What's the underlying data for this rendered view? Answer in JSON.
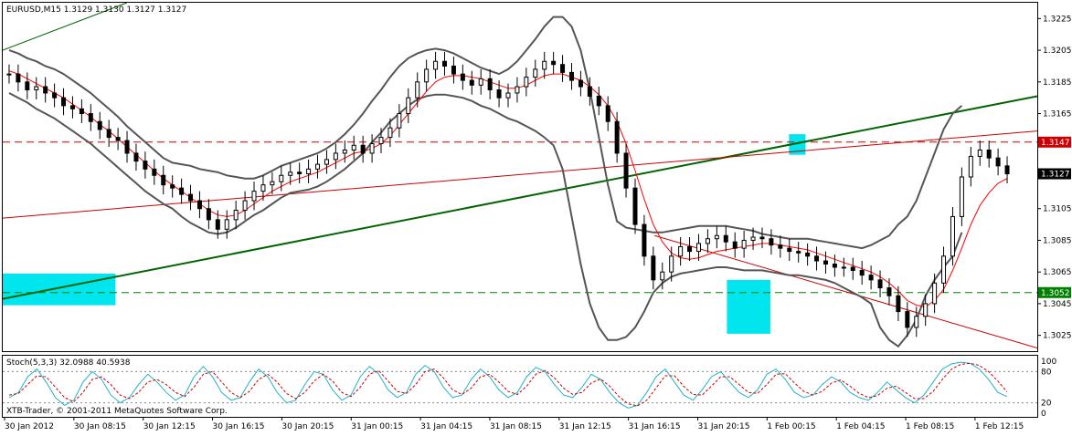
{
  "chart_data": {
    "type": "candlestick",
    "header": "EURUSD,M15  1.3129 1.3130 1.3127 1.3127",
    "colors": {
      "price": "#000000",
      "ma": "#ff0000",
      "bollinger": "#555555",
      "trend_green": "#006400",
      "trend_red": "#cc0000",
      "highlight": "#00e5ee",
      "stoch_main": "#20b2c8",
      "stoch_signal": "#cc0000",
      "level_red": "#cc0000",
      "level_green": "#008000"
    },
    "price_axis": {
      "min": 1.3015,
      "max": 1.3235,
      "ticks": [
        "1.3225",
        "1.3205",
        "1.3185",
        "1.3165",
        "1.3105",
        "1.3085",
        "1.3065",
        "1.3045",
        "1.3025"
      ],
      "tick_values": [
        1.3225,
        1.3205,
        1.3185,
        1.3165,
        1.3105,
        1.3085,
        1.3065,
        1.3045,
        1.3025
      ]
    },
    "time_axis": {
      "labels": [
        "30 Jan 2012",
        "30 Jan 08:15",
        "30 Jan 12:15",
        "30 Jan 16:15",
        "30 Jan 20:15",
        "31 Jan 00:15",
        "31 Jan 04:15",
        "31 Jan 08:15",
        "31 Jan 12:15",
        "31 Jan 16:15",
        "31 Jan 20:15",
        "1 Feb 00:15",
        "1 Feb 04:15",
        "1 Feb 08:15",
        "1 Feb 12:15"
      ]
    },
    "levels": [
      {
        "label": "1.3147",
        "value": 1.3147,
        "style": "red"
      },
      {
        "label": "1.3052",
        "value": 1.3052,
        "style": "green"
      }
    ],
    "current_price": {
      "label": "1.3127",
      "value": 1.3127
    },
    "price_series": {
      "close": [
        1.319,
        1.3185,
        1.318,
        1.3182,
        1.3178,
        1.3175,
        1.317,
        1.3168,
        1.3165,
        1.316,
        1.3155,
        1.315,
        1.3148,
        1.314,
        1.3135,
        1.313,
        1.3126,
        1.312,
        1.3118,
        1.3114,
        1.311,
        1.3105,
        1.3098,
        1.3092,
        1.3098,
        1.3104,
        1.311,
        1.3116,
        1.312,
        1.3122,
        1.3126,
        1.3128,
        1.3127,
        1.313,
        1.3133,
        1.3136,
        1.314,
        1.3142,
        1.3145,
        1.314,
        1.3146,
        1.315,
        1.3156,
        1.3165,
        1.3175,
        1.3185,
        1.3193,
        1.3198,
        1.3195,
        1.319,
        1.3186,
        1.3183,
        1.3187,
        1.318,
        1.3175,
        1.3178,
        1.3182,
        1.3188,
        1.3193,
        1.3198,
        1.3196,
        1.3191,
        1.3186,
        1.3182,
        1.3176,
        1.317,
        1.316,
        1.314,
        1.3118,
        1.3095,
        1.3075,
        1.306,
        1.3065,
        1.3075,
        1.3081,
        1.3078,
        1.3083,
        1.3086,
        1.3088,
        1.3084,
        1.308,
        1.3085,
        1.3087,
        1.3086,
        1.3082,
        1.308,
        1.3078,
        1.3077,
        1.3075,
        1.3072,
        1.307,
        1.3068,
        1.3068,
        1.3066,
        1.3063,
        1.306,
        1.3055,
        1.305,
        1.304,
        1.303,
        1.3037,
        1.3045,
        1.3058,
        1.3075,
        1.31,
        1.3125,
        1.3138,
        1.3142,
        1.3137,
        1.3132,
        1.3127
      ],
      "ma": [
        1.3192,
        1.319,
        1.3187,
        1.3184,
        1.3181,
        1.3178,
        1.3175,
        1.3171,
        1.3167,
        1.3163,
        1.3158,
        1.3154,
        1.3149,
        1.3144,
        1.3139,
        1.3134,
        1.3129,
        1.3124,
        1.312,
        1.3116,
        1.3112,
        1.3108,
        1.3104,
        1.3101,
        1.31,
        1.3101,
        1.3104,
        1.3108,
        1.3112,
        1.3116,
        1.3119,
        1.3122,
        1.3124,
        1.3126,
        1.3128,
        1.3131,
        1.3134,
        1.3137,
        1.314,
        1.3141,
        1.3143,
        1.3146,
        1.3151,
        1.3158,
        1.3165,
        1.3172,
        1.3179,
        1.3185,
        1.3188,
        1.3189,
        1.3189,
        1.3188,
        1.3187,
        1.3185,
        1.3183,
        1.3181,
        1.3181,
        1.3183,
        1.3186,
        1.3189,
        1.319,
        1.319,
        1.3188,
        1.3186,
        1.3182,
        1.3177,
        1.317,
        1.316,
        1.3146,
        1.3129,
        1.3111,
        1.3095,
        1.3084,
        1.3077,
        1.3074,
        1.3073,
        1.3074,
        1.3076,
        1.3078,
        1.3079,
        1.308,
        1.3081,
        1.3082,
        1.3083,
        1.3083,
        1.3082,
        1.3081,
        1.308,
        1.3079,
        1.3077,
        1.3075,
        1.3073,
        1.3071,
        1.3069,
        1.3067,
        1.3065,
        1.3062,
        1.3058,
        1.3053,
        1.3047,
        1.3044,
        1.3043,
        1.3047,
        1.3054,
        1.3066,
        1.308,
        1.3095,
        1.3107,
        1.3115,
        1.3121,
        1.3124
      ],
      "bb_upper": [
        1.3205,
        1.3203,
        1.32,
        1.3198,
        1.3195,
        1.3193,
        1.319,
        1.3186,
        1.3182,
        1.3178,
        1.3173,
        1.3168,
        1.3163,
        1.3157,
        1.3152,
        1.3147,
        1.3142,
        1.3137,
        1.3134,
        1.3133,
        1.3132,
        1.313,
        1.3129,
        1.3128,
        1.3126,
        1.3125,
        1.3124,
        1.3124,
        1.3126,
        1.3129,
        1.3132,
        1.3134,
        1.3136,
        1.3138,
        1.314,
        1.3143,
        1.3147,
        1.3152,
        1.3158,
        1.3165,
        1.3173,
        1.318,
        1.3188,
        1.3195,
        1.32,
        1.3203,
        1.3205,
        1.3206,
        1.3205,
        1.3203,
        1.32,
        1.3197,
        1.3194,
        1.3192,
        1.319,
        1.3193,
        1.3198,
        1.3205,
        1.3212,
        1.322,
        1.3226,
        1.3226,
        1.322,
        1.3205,
        1.318,
        1.315,
        1.312,
        1.3097,
        1.3093,
        1.3092,
        1.3091,
        1.309,
        1.309,
        1.3091,
        1.3092,
        1.3093,
        1.3094,
        1.3094,
        1.3094,
        1.3094,
        1.3093,
        1.3092,
        1.3091,
        1.3089,
        1.3088,
        1.3087,
        1.3086,
        1.3086,
        1.3086,
        1.3085,
        1.3084,
        1.3083,
        1.3082,
        1.3081,
        1.308,
        1.3082,
        1.3085,
        1.3088,
        1.3095,
        1.31,
        1.311,
        1.3125,
        1.314,
        1.3155,
        1.3165,
        1.317
      ],
      "bb_lower": [
        1.3178,
        1.3175,
        1.3172,
        1.3168,
        1.3165,
        1.3162,
        1.3158,
        1.3154,
        1.315,
        1.3146,
        1.3141,
        1.3136,
        1.3131,
        1.3126,
        1.3121,
        1.3116,
        1.3112,
        1.3108,
        1.3105,
        1.31,
        1.3096,
        1.3093,
        1.309,
        1.3089,
        1.309,
        1.3093,
        1.3097,
        1.3101,
        1.3104,
        1.3108,
        1.3112,
        1.3115,
        1.3116,
        1.3117,
        1.3119,
        1.3122,
        1.3126,
        1.313,
        1.3135,
        1.314,
        1.3147,
        1.3153,
        1.316,
        1.3165,
        1.317,
        1.3174,
        1.3176,
        1.3177,
        1.3177,
        1.3176,
        1.3175,
        1.3173,
        1.317,
        1.3168,
        1.3165,
        1.3162,
        1.316,
        1.3157,
        1.3154,
        1.315,
        1.3145,
        1.313,
        1.31,
        1.307,
        1.3045,
        1.303,
        1.3022,
        1.3022,
        1.3024,
        1.303,
        1.304,
        1.3052,
        1.3058,
        1.3062,
        1.3064,
        1.3065,
        1.3066,
        1.3067,
        1.3068,
        1.3068,
        1.3067,
        1.3066,
        1.3066,
        1.3066,
        1.3065,
        1.3064,
        1.3063,
        1.3063,
        1.3062,
        1.3061,
        1.306,
        1.3058,
        1.3055,
        1.3052,
        1.3049,
        1.3045,
        1.303,
        1.3022,
        1.3018,
        1.3025,
        1.3035,
        1.305,
        1.306,
        1.3068,
        1.3075,
        1.309
      ]
    },
    "highlight_boxes": [
      {
        "x0": 0.0,
        "x1": 0.109,
        "y0": 1.3064,
        "y1": 1.3044
      },
      {
        "x0": 0.7,
        "x1": 0.742,
        "y0": 1.306,
        "y1": 1.3026
      },
      {
        "x0": 0.76,
        "x1": 0.776,
        "y0": 1.3152,
        "y1": 1.3139
      }
    ],
    "trendlines": [
      {
        "name": "green",
        "x0": 0.0,
        "y0": 1.3048,
        "x1": 1.0,
        "y1": 1.3176
      },
      {
        "name": "red_up",
        "x0": 0.0,
        "y0": 1.3099,
        "x1": 1.0,
        "y1": 1.3154
      },
      {
        "name": "red_down",
        "x0": 0.63,
        "y0": 1.3088,
        "x1": 1.0,
        "y1": 1.3017
      },
      {
        "name": "thin_top",
        "x0": 0.0,
        "y0": 1.3205,
        "x1": 0.12,
        "y1": 1.3235
      }
    ],
    "stoch": {
      "label": "Stoch(5,3,3) 32.0988 40.5938",
      "axis_ticks": [
        "100",
        "80",
        "20",
        "0"
      ],
      "axis_values": [
        100,
        80,
        20,
        0
      ],
      "main": [
        30,
        40,
        70,
        85,
        60,
        30,
        15,
        25,
        60,
        80,
        65,
        35,
        20,
        30,
        55,
        75,
        60,
        40,
        25,
        35,
        70,
        90,
        70,
        40,
        25,
        30,
        60,
        85,
        70,
        40,
        20,
        25,
        55,
        80,
        75,
        45,
        25,
        35,
        70,
        90,
        75,
        45,
        30,
        40,
        75,
        92,
        80,
        50,
        30,
        35,
        65,
        85,
        70,
        45,
        30,
        40,
        70,
        88,
        80,
        55,
        35,
        30,
        50,
        75,
        65,
        40,
        20,
        10,
        15,
        40,
        70,
        85,
        60,
        35,
        25,
        45,
        70,
        80,
        60,
        40,
        30,
        45,
        75,
        85,
        65,
        40,
        30,
        35,
        55,
        70,
        60,
        40,
        30,
        25,
        40,
        60,
        45,
        30,
        20,
        35,
        60,
        85,
        95,
        98,
        96,
        85,
        65,
        40,
        32
      ],
      "signal": [
        35,
        38,
        55,
        72,
        70,
        50,
        30,
        22,
        40,
        65,
        70,
        55,
        35,
        28,
        40,
        60,
        65,
        55,
        40,
        32,
        50,
        75,
        80,
        60,
        40,
        30,
        42,
        65,
        75,
        60,
        38,
        28,
        40,
        62,
        75,
        62,
        40,
        32,
        50,
        75,
        82,
        62,
        42,
        38,
        55,
        80,
        85,
        68,
        45,
        36,
        48,
        70,
        75,
        60,
        42,
        36,
        52,
        75,
        82,
        68,
        48,
        36,
        40,
        58,
        66,
        52,
        32,
        18,
        14,
        25,
        48,
        72,
        72,
        52,
        36,
        35,
        52,
        70,
        70,
        55,
        40,
        38,
        55,
        75,
        76,
        58,
        42,
        35,
        42,
        58,
        64,
        52,
        38,
        30,
        34,
        48,
        52,
        40,
        28,
        28,
        42,
        65,
        85,
        94,
        96,
        92,
        80,
        62,
        41
      ]
    },
    "copyright": "XTB-Trader, © 2001-2011 MetaQuotes Software Corp."
  }
}
